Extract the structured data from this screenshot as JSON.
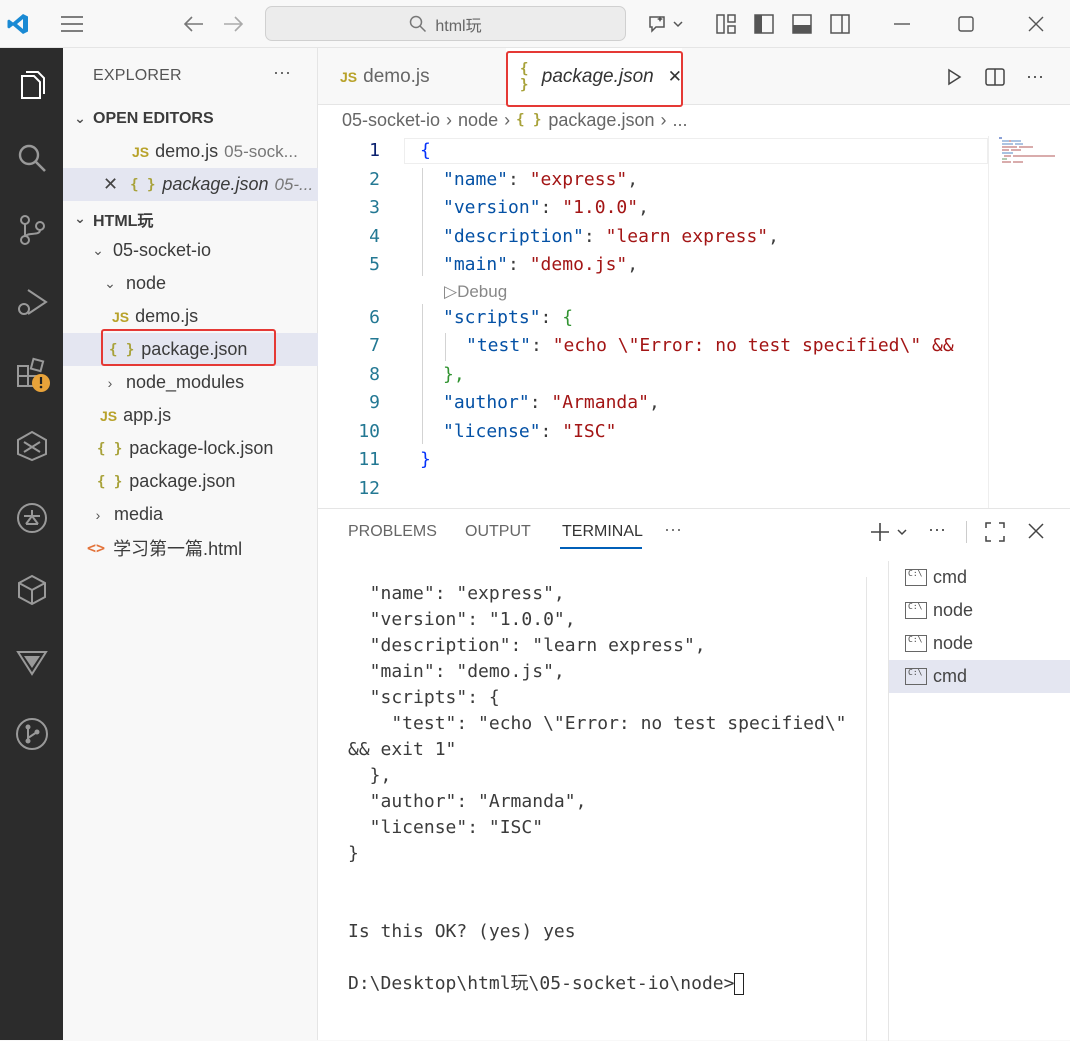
{
  "titlebar": {
    "search_text": "html玩",
    "search_icon": "search-icon"
  },
  "sidebar": {
    "title": "EXPLORER",
    "more": "···",
    "open_editors": {
      "header": "OPEN EDITORS",
      "items": [
        {
          "badge": "JS",
          "name": "demo.js",
          "path": "05-sock..."
        },
        {
          "badge": "{ }",
          "name": "package.json",
          "path": "05-..."
        }
      ]
    },
    "workspace": {
      "header": "HTML玩",
      "tree": [
        {
          "badge": "",
          "name": "05-socket-io"
        },
        {
          "badge": "",
          "name": "node"
        },
        {
          "badge": "JS",
          "name": "demo.js"
        },
        {
          "badge": "{ }",
          "name": "package.json"
        },
        {
          "badge": "",
          "name": "node_modules"
        },
        {
          "badge": "JS",
          "name": "app.js"
        },
        {
          "badge": "{ }",
          "name": "package-lock.json"
        },
        {
          "badge": "{ }",
          "name": "package.json"
        },
        {
          "badge": "",
          "name": "media"
        },
        {
          "badge": "<>",
          "name": "学习第一篇.html"
        }
      ]
    }
  },
  "editor": {
    "tabs": [
      {
        "badge": "JS",
        "label": "demo.js"
      },
      {
        "badge": "{ }",
        "label": "package.json",
        "close": "✕"
      }
    ],
    "actions": {
      "more": "···"
    },
    "breadcrumb": [
      "05-socket-io",
      "node",
      "package.json",
      "..."
    ],
    "breadcrumb_badge": "{ }",
    "code_lens": "Debug",
    "line_numbers": [
      "1",
      "2",
      "3",
      "4",
      "5",
      "6",
      "7",
      "8",
      "9",
      "10",
      "11",
      "12"
    ],
    "code": {
      "l1": "{",
      "l2_key": "\"name\"",
      "l2_val": "\"express\"",
      "l3_key": "\"version\"",
      "l3_val": "\"1.0.0\"",
      "l4_key": "\"description\"",
      "l4_val": "\"learn express\"",
      "l5_key": "\"main\"",
      "l5_val": "\"demo.js\"",
      "l6_key": "\"scripts\"",
      "l6_brace": "{",
      "l7_key": "\"test\"",
      "l7_val": "\"echo \\\"Error: no test specified\\\" &&",
      "l8": "},",
      "l9_key": "\"author\"",
      "l9_val": "\"Armanda\"",
      "l10_key": "\"license\"",
      "l10_val": "\"ISC\"",
      "l11": "}"
    }
  },
  "panel": {
    "tabs": [
      "PROBLEMS",
      "OUTPUT",
      "TERMINAL"
    ],
    "active_tab": "TERMINAL",
    "more": "···",
    "terminal_output": "  \"name\": \"express\",\n  \"version\": \"1.0.0\",\n  \"description\": \"learn express\",\n  \"main\": \"demo.js\",\n  \"scripts\": {\n    \"test\": \"echo \\\"Error: no test specified\\\"\n&& exit 1\"\n  },\n  \"author\": \"Armanda\",\n  \"license\": \"ISC\"\n}\n\n\nIs this OK? (yes) yes\n\nD:\\Desktop\\html玩\\05-socket-io\\node>",
    "terminals": [
      {
        "icon_text": "C:\\",
        "name": "cmd"
      },
      {
        "icon_text": "C:\\",
        "name": "node"
      },
      {
        "icon_text": "C:\\",
        "name": "node"
      },
      {
        "icon_text": "C:\\",
        "name": "cmd"
      }
    ]
  },
  "colors": {
    "activity_bar": "#2c2c2c",
    "highlight": "#e53935",
    "selected_row": "#e4e6f1",
    "json_key": "#0451a5",
    "json_string": "#a31515"
  }
}
